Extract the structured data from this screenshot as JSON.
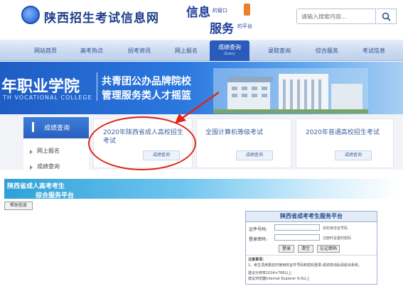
{
  "header": {
    "site_title": "陕西招生考试信息网",
    "slogan_line1": "信息",
    "slogan_line1_small": "的窗口",
    "slogan_line2": "服务",
    "slogan_line2_small": "的平台",
    "search_placeholder": "请输入搜索内容..."
  },
  "nav": {
    "items": [
      "网站首页",
      "高考热点",
      "招考资讯",
      "网上报名",
      "成绩查询",
      "录取查询",
      "综合服务",
      "考试信息"
    ],
    "active_sub": "Query"
  },
  "banner": {
    "school": "年职业学院",
    "school_en": "TH VOCATIONAL COLLEGE",
    "line1": "共青团公办品牌院校",
    "line2": "管理服务类人才摇篮"
  },
  "sidebar": {
    "header": "成绩查询",
    "items": [
      "网上报名",
      "成绩查询"
    ]
  },
  "cards": [
    {
      "title": "2020年陕西省成人高校招生考试",
      "button": "成绩查询"
    },
    {
      "title": "全国计算机等级考试",
      "button": "成绩查询"
    },
    {
      "title": "2020年普通高校招生考试",
      "button": "成绩查询"
    }
  ],
  "system": {
    "title_line1": "陕西省成人高考考生",
    "title_line2": "综合服务平台",
    "help_button": "帮助信息"
  },
  "login": {
    "title": "陕西省成考考生服务平台",
    "label_id": "证件号码:",
    "hint_id": "本的身份证号码",
    "label_pwd": "登录密码:",
    "hint_pwd": "注册时设置的密码",
    "buttons": [
      "登录",
      "清空",
      "忘记密码"
    ],
    "note_title": "注意事项:",
    "note_1": "1、考生须用报名时使用的证件号码和密码登录,成绩查询后请退出系统。",
    "note_2": "建议分辨率1024×768以上",
    "note_3": "建议浏览器Internet Explorer 9.0以上"
  },
  "colors": {
    "primary": "#2a5bbb",
    "annotation": "#e2231a"
  }
}
